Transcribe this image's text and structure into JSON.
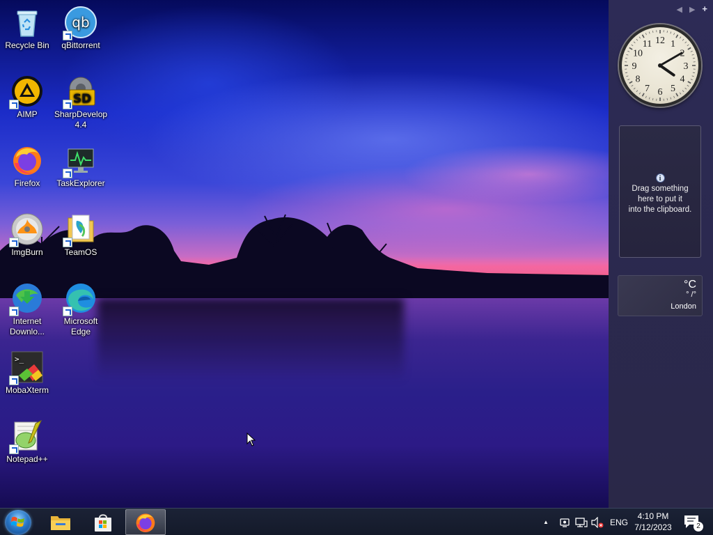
{
  "desktop": {
    "icons": [
      {
        "label": "Recycle Bin",
        "icon": "recycle-bin-icon"
      },
      {
        "label": "qBittorrent",
        "icon": "qbittorrent-icon",
        "glyph_text": "qb"
      },
      {
        "label": "AIMP",
        "icon": "aimp-icon"
      },
      {
        "label": "SharpDevelop 4.4",
        "icon": "sharpdevelop-icon",
        "glyph_text": "SD"
      },
      {
        "label": "Firefox",
        "icon": "firefox-icon"
      },
      {
        "label": "TaskExplorer",
        "icon": "taskexplorer-icon"
      },
      {
        "label": "ImgBurn",
        "icon": "imgburn-icon"
      },
      {
        "label": "TeamOS",
        "icon": "teamos-icon"
      },
      {
        "label": "Internet Downlo...",
        "icon": "internet-download-manager-icon"
      },
      {
        "label": "Microsoft Edge",
        "icon": "edge-icon"
      },
      {
        "label": "MobaXterm",
        "icon": "mobaxterm-icon"
      },
      {
        "label": "Notepad++",
        "icon": "notepadpp-icon"
      }
    ]
  },
  "sidebar": {
    "controls": {
      "prev": "◀",
      "next": "▶",
      "add": "+"
    },
    "clock": {
      "hour": 4,
      "minute": 10,
      "numbers": [
        "12",
        "1",
        "2",
        "3",
        "4",
        "5",
        "6",
        "7",
        "8",
        "9",
        "10",
        "11"
      ]
    },
    "clipboard": {
      "info": "i",
      "line1": "Drag something",
      "line2": "here to put it",
      "line3": "into the clipboard."
    },
    "weather": {
      "unit": "°C",
      "range": "° /°",
      "city": "London"
    }
  },
  "taskbar": {
    "pinned": [
      {
        "name": "file-explorer",
        "icon": "folder-icon"
      },
      {
        "name": "microsoft-store",
        "icon": "store-icon"
      },
      {
        "name": "firefox",
        "icon": "firefox-icon",
        "active": true
      }
    ],
    "tray": {
      "chevron": "▲",
      "language": "ENG",
      "time": "4:10 PM",
      "date": "7/12/2023",
      "notifications": "2"
    }
  },
  "colors": {
    "sidebar_bg": "#2d2b56",
    "taskbar_bg": "#1b2236",
    "sky_top": "#050a5c",
    "sunset_pink": "#f0608f"
  }
}
